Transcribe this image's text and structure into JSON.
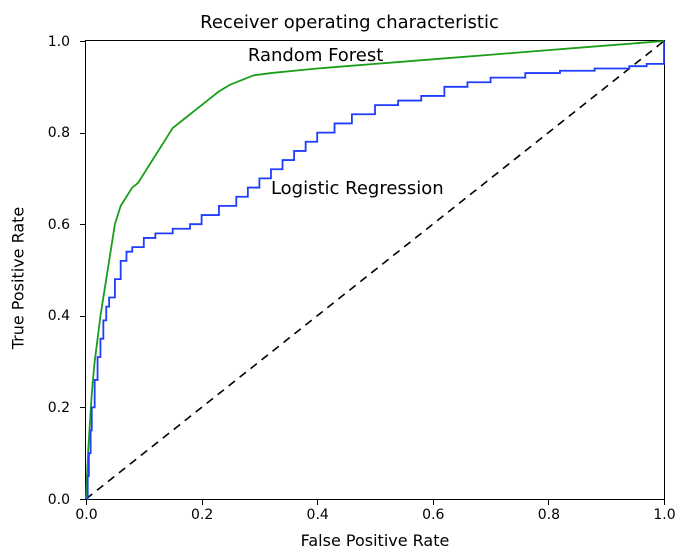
{
  "chart_data": {
    "type": "line",
    "title": "Receiver operating characteristic",
    "xlabel": "False Positive Rate",
    "ylabel": "True Positive Rate",
    "xlim": [
      0.0,
      1.0
    ],
    "ylim": [
      0.0,
      1.0
    ],
    "xticks": [
      0.0,
      0.2,
      0.4,
      0.6,
      0.8,
      1.0
    ],
    "yticks": [
      0.0,
      0.2,
      0.4,
      0.6,
      0.8,
      1.0
    ],
    "xtick_labels": [
      "0.0",
      "0.2",
      "0.4",
      "0.6",
      "0.8",
      "1.0"
    ],
    "ytick_labels": [
      "0.0",
      "0.2",
      "0.4",
      "0.6",
      "0.8",
      "1.0"
    ],
    "diagonal": {
      "from": [
        0.0,
        0.0
      ],
      "to": [
        1.0,
        1.0
      ],
      "style": "dashed",
      "color": "#000000"
    },
    "series": [
      {
        "name": "Random Forest",
        "color": "#1a9e1a",
        "annotation_pos": [
          0.28,
          0.97
        ],
        "x": [
          0.0,
          0.002,
          0.004,
          0.006,
          0.008,
          0.01,
          0.012,
          0.015,
          0.02,
          0.025,
          0.03,
          0.035,
          0.04,
          0.045,
          0.05,
          0.06,
          0.07,
          0.08,
          0.09,
          0.1,
          0.11,
          0.12,
          0.13,
          0.14,
          0.15,
          0.17,
          0.19,
          0.21,
          0.23,
          0.25,
          0.27,
          0.29,
          0.32,
          0.36,
          0.4,
          0.45,
          0.5,
          0.6,
          0.7,
          0.8,
          0.9,
          1.0
        ],
        "y": [
          0.0,
          0.06,
          0.11,
          0.15,
          0.19,
          0.23,
          0.26,
          0.3,
          0.35,
          0.4,
          0.44,
          0.48,
          0.52,
          0.56,
          0.6,
          0.64,
          0.66,
          0.68,
          0.69,
          0.71,
          0.73,
          0.75,
          0.77,
          0.79,
          0.81,
          0.83,
          0.85,
          0.87,
          0.89,
          0.905,
          0.915,
          0.925,
          0.93,
          0.935,
          0.94,
          0.945,
          0.95,
          0.96,
          0.97,
          0.98,
          0.99,
          1.0
        ]
      },
      {
        "name": "Logistic Regression",
        "color": "#1f3cff",
        "annotation_pos": [
          0.32,
          0.68
        ],
        "x": [
          0.0,
          0.003,
          0.005,
          0.008,
          0.01,
          0.015,
          0.02,
          0.025,
          0.03,
          0.035,
          0.04,
          0.05,
          0.06,
          0.07,
          0.08,
          0.1,
          0.12,
          0.15,
          0.18,
          0.2,
          0.23,
          0.26,
          0.28,
          0.3,
          0.32,
          0.34,
          0.36,
          0.38,
          0.4,
          0.43,
          0.46,
          0.5,
          0.54,
          0.58,
          0.62,
          0.66,
          0.7,
          0.76,
          0.82,
          0.88,
          0.94,
          0.97,
          1.0
        ],
        "y": [
          0.0,
          0.05,
          0.1,
          0.15,
          0.2,
          0.26,
          0.31,
          0.35,
          0.39,
          0.42,
          0.44,
          0.48,
          0.52,
          0.54,
          0.55,
          0.57,
          0.58,
          0.59,
          0.6,
          0.62,
          0.64,
          0.66,
          0.68,
          0.7,
          0.72,
          0.74,
          0.76,
          0.78,
          0.8,
          0.82,
          0.84,
          0.86,
          0.87,
          0.88,
          0.9,
          0.91,
          0.92,
          0.93,
          0.935,
          0.94,
          0.945,
          0.95,
          1.0
        ]
      }
    ]
  }
}
